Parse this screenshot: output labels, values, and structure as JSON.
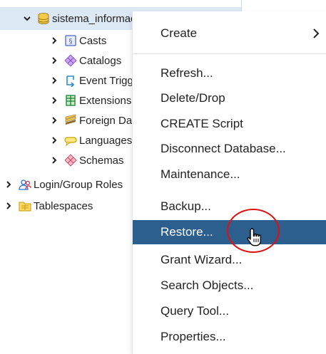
{
  "tree": {
    "database": {
      "label": "sistema_informacion",
      "expanded": true
    },
    "children": [
      {
        "label": "Casts",
        "icon": "casts-icon"
      },
      {
        "label": "Catalogs",
        "icon": "catalogs-icon"
      },
      {
        "label": "Event Triggers",
        "icon": "event-triggers-icon"
      },
      {
        "label": "Extensions",
        "icon": "extensions-icon"
      },
      {
        "label": "Foreign Data Wrappers",
        "icon": "foreign-data-wrappers-icon"
      },
      {
        "label": "Languages",
        "icon": "languages-icon"
      },
      {
        "label": "Schemas",
        "icon": "schemas-icon"
      }
    ],
    "roots": [
      {
        "label": "Login/Group Roles",
        "icon": "login-group-roles-icon"
      },
      {
        "label": "Tablespaces",
        "icon": "tablespaces-icon"
      }
    ]
  },
  "context_menu": {
    "items": [
      {
        "label": "Create",
        "has_submenu": true
      },
      {
        "label": "Refresh..."
      },
      {
        "label": "Delete/Drop"
      },
      {
        "label": "CREATE Script"
      },
      {
        "label": "Disconnect Database..."
      },
      {
        "label": "Maintenance..."
      },
      {
        "label": "Backup..."
      },
      {
        "label": "Restore...",
        "active": true
      },
      {
        "label": "Grant Wizard..."
      },
      {
        "label": "Search Objects..."
      },
      {
        "label": "Query Tool..."
      },
      {
        "label": "Properties..."
      }
    ]
  },
  "colors": {
    "selected_row": "#dde8f5",
    "menu_active": "#2c5f8e",
    "annotation_circle": "#e01010"
  }
}
